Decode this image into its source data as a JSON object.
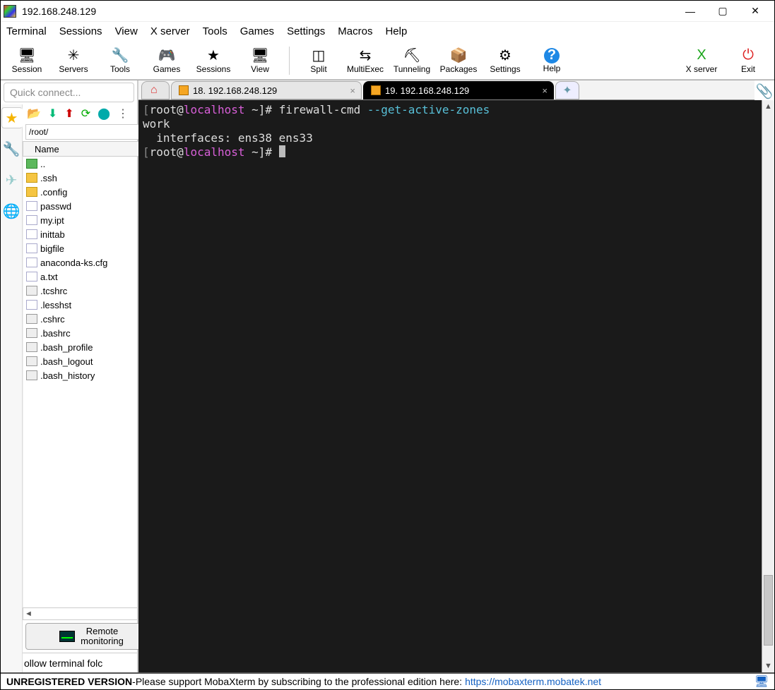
{
  "window": {
    "title": "192.168.248.129",
    "minimize": "—",
    "maximize": "▢",
    "close": "✕"
  },
  "menu": [
    "Terminal",
    "Sessions",
    "View",
    "X server",
    "Tools",
    "Games",
    "Settings",
    "Macros",
    "Help"
  ],
  "toolbar": [
    {
      "id": "session",
      "label": "Session",
      "icon": "🖥"
    },
    {
      "id": "servers",
      "label": "Servers",
      "icon": "✳"
    },
    {
      "id": "tools",
      "label": "Tools",
      "icon": "🔧"
    },
    {
      "id": "games",
      "label": "Games",
      "icon": "🎮"
    },
    {
      "id": "sessions",
      "label": "Sessions",
      "icon": "★"
    },
    {
      "id": "view",
      "label": "View",
      "icon": "🖥"
    },
    {
      "id": "sep1",
      "sep": true
    },
    {
      "id": "split",
      "label": "Split",
      "icon": "◫"
    },
    {
      "id": "multiexec",
      "label": "MultiExec",
      "icon": "⇆"
    },
    {
      "id": "tunneling",
      "label": "Tunneling",
      "icon": "⛏"
    },
    {
      "id": "packages",
      "label": "Packages",
      "icon": "📦"
    },
    {
      "id": "settings",
      "label": "Settings",
      "icon": "⚙"
    },
    {
      "id": "help",
      "label": "Help",
      "icon": "?"
    },
    {
      "id": "spacer",
      "spacer": true
    },
    {
      "id": "xserver",
      "label": "X server",
      "icon": "X",
      "color": "#1aa51a"
    },
    {
      "id": "exit",
      "label": "Exit",
      "icon": "⏻",
      "color": "#d22"
    }
  ],
  "left": {
    "quick_connect_placeholder": "Quick connect...",
    "side_tabs": [
      {
        "id": "fav",
        "icon": "★",
        "color": "#f5b400",
        "active": true
      },
      {
        "id": "tools",
        "icon": "🔧",
        "color": "#d33"
      },
      {
        "id": "send",
        "icon": "✈",
        "color": "#9cc"
      },
      {
        "id": "globe",
        "icon": "🌐",
        "color": "#e67e22"
      }
    ],
    "file_toolbar_icons": [
      {
        "id": "open",
        "icon": "📂",
        "color": "#e6a100"
      },
      {
        "id": "download",
        "icon": "⬇",
        "color": "#0b7"
      },
      {
        "id": "upload",
        "icon": "⬆",
        "color": "#c00"
      },
      {
        "id": "refresh",
        "icon": "⟳",
        "color": "#0a0"
      },
      {
        "id": "newdir",
        "icon": "⬤",
        "color": "#0aa"
      },
      {
        "id": "more",
        "icon": "⋮",
        "color": "#555"
      }
    ],
    "path": "/root/",
    "name_header": "Name",
    "files": [
      {
        "name": "..",
        "type": "folder-g"
      },
      {
        "name": ".ssh",
        "type": "folder"
      },
      {
        "name": ".config",
        "type": "folder"
      },
      {
        "name": "passwd",
        "type": "file"
      },
      {
        "name": "my.ipt",
        "type": "file"
      },
      {
        "name": "inittab",
        "type": "file"
      },
      {
        "name": "bigfile",
        "type": "file"
      },
      {
        "name": "anaconda-ks.cfg",
        "type": "file"
      },
      {
        "name": "a.txt",
        "type": "file"
      },
      {
        "name": ".tcshrc",
        "type": "file-g"
      },
      {
        "name": ".lesshst",
        "type": "file"
      },
      {
        "name": ".cshrc",
        "type": "file-g"
      },
      {
        "name": ".bashrc",
        "type": "file-g"
      },
      {
        "name": ".bash_profile",
        "type": "file-g"
      },
      {
        "name": ".bash_logout",
        "type": "file-g"
      },
      {
        "name": ".bash_history",
        "type": "file-g"
      }
    ],
    "remote_monitoring_line1": "Remote",
    "remote_monitoring_line2": "monitoring",
    "follow_text": "ollow terminal folc"
  },
  "tabs": [
    {
      "id": "home",
      "type": "home"
    },
    {
      "id": "t18",
      "type": "session",
      "label": "18. 192.168.248.129",
      "active": false
    },
    {
      "id": "t19",
      "type": "session",
      "label": "19. 192.168.248.129",
      "active": true
    },
    {
      "id": "add",
      "type": "add"
    }
  ],
  "terminal": {
    "prompt_open": "[",
    "user": "root",
    "at": "@",
    "host": "localhost",
    "rest": " ~]# ",
    "command": "firewall-cmd ",
    "flag": "--get-active-zones",
    "line2": "work",
    "line3": "  interfaces: ens38 ens33"
  },
  "status": {
    "unreg": "UNREGISTERED VERSION",
    "dash": "  -  ",
    "msg": "Please support MobaXterm by subscribing to the professional edition here:",
    "link": "https://mobaxterm.mobatek.net"
  }
}
